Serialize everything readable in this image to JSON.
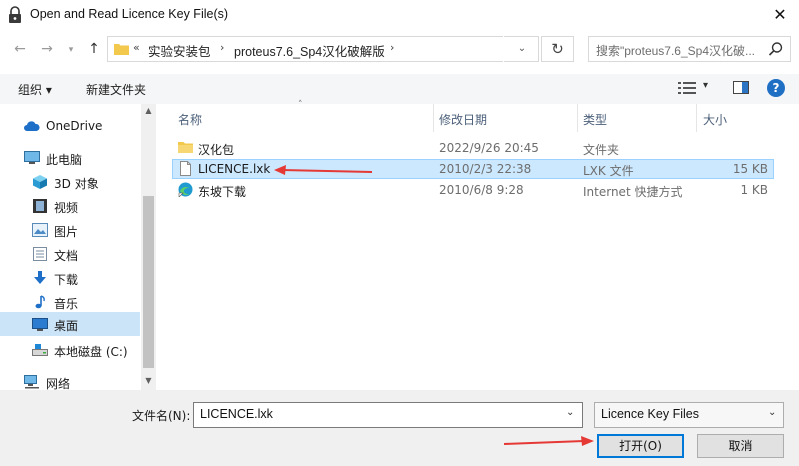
{
  "window": {
    "title": "Open and Read Licence Key File(s)"
  },
  "nav": {
    "address_prefix": "«",
    "breadcrumbs": [
      "实验安装包",
      "proteus7.6_Sp4汉化破解版"
    ],
    "search_placeholder": "搜索\"proteus7.6_Sp4汉化破..."
  },
  "toolbar": {
    "organize_label": "组织 ▾",
    "new_folder_label": "新建文件夹"
  },
  "sidebar": {
    "items": [
      {
        "label": "OneDrive",
        "icon": "cloud-icon"
      },
      {
        "label": "此电脑",
        "icon": "computer-icon"
      },
      {
        "label": "3D 对象",
        "icon": "cube-icon"
      },
      {
        "label": "视频",
        "icon": "video-icon"
      },
      {
        "label": "图片",
        "icon": "picture-icon"
      },
      {
        "label": "文档",
        "icon": "document-icon"
      },
      {
        "label": "下载",
        "icon": "download-icon"
      },
      {
        "label": "音乐",
        "icon": "music-icon"
      },
      {
        "label": "桌面",
        "icon": "desktop-icon",
        "selected": true
      },
      {
        "label": "本地磁盘 (C:)",
        "icon": "drive-icon"
      },
      {
        "label": "网络",
        "icon": "network-icon"
      }
    ]
  },
  "file_list": {
    "columns": [
      "名称",
      "修改日期",
      "类型",
      "大小"
    ],
    "rows": [
      {
        "name": "汉化包",
        "modified": "2022/9/26 20:45",
        "type": "文件夹",
        "size": "",
        "icon": "folder-icon"
      },
      {
        "name": "LICENCE.lxk",
        "modified": "2010/2/3 22:38",
        "type": "LXK 文件",
        "size": "15 KB",
        "icon": "file-icon",
        "selected": true
      },
      {
        "name": "东坡下载",
        "modified": "2010/6/8 9:28",
        "type": "Internet 快捷方式",
        "size": "1 KB",
        "icon": "edge-icon"
      }
    ]
  },
  "bottom": {
    "filename_label": "文件名(N):",
    "filename_value": "LICENCE.lxk",
    "filetype_value": "Licence Key Files",
    "open_label": "打开(O)",
    "cancel_label": "取消"
  },
  "colors": {
    "accent": "#0078d7",
    "selection": "#cce8ff",
    "annotation_arrow": "#e53935"
  }
}
